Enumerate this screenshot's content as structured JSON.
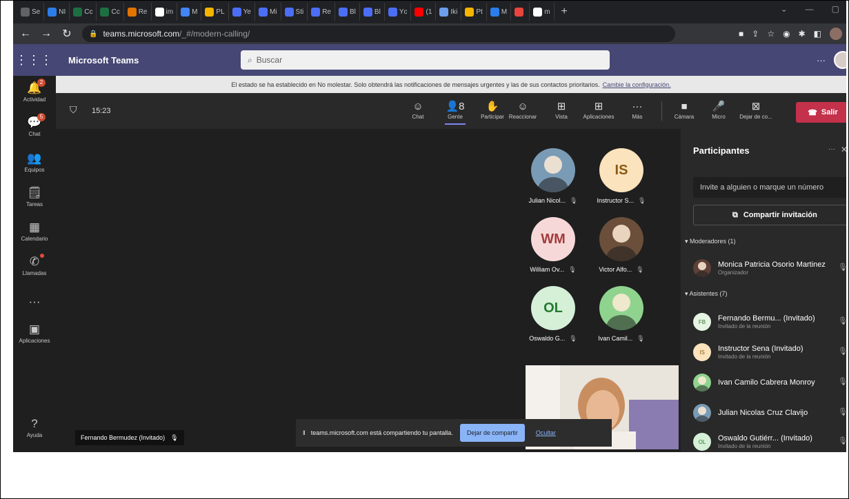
{
  "browser": {
    "tabs": [
      {
        "label": "Se",
        "color": "#5f6368"
      },
      {
        "label": "NI",
        "color": "#2b7de9"
      },
      {
        "label": "Cc",
        "color": "#1d6f42"
      },
      {
        "label": "Cc",
        "color": "#1d6f42"
      },
      {
        "label": "Re",
        "color": "#e37400"
      },
      {
        "label": "im",
        "color": "#ffffff"
      },
      {
        "label": "M",
        "color": "#4285f4"
      },
      {
        "label": "PL",
        "color": "#f4b400"
      },
      {
        "label": "Ye",
        "color": "#4c6ef5"
      },
      {
        "label": "Mi",
        "color": "#4c6ef5"
      },
      {
        "label": "Sti",
        "color": "#4c6ef5"
      },
      {
        "label": "Re",
        "color": "#4c6ef5"
      },
      {
        "label": "Bl",
        "color": "#4c6ef5"
      },
      {
        "label": "Bl",
        "color": "#4c6ef5"
      },
      {
        "label": "Yc",
        "color": "#4c6ef5"
      },
      {
        "label": "(1",
        "color": "#ff0000"
      },
      {
        "label": "Iki",
        "color": "#6d9eeb"
      },
      {
        "label": "Pt",
        "color": "#f4b400"
      },
      {
        "label": "M",
        "color": "#2b7de9"
      },
      {
        "label": "",
        "color": "#e8453c"
      },
      {
        "label": "m",
        "color": "#ffffff"
      }
    ],
    "new_tab": "+",
    "url_host": "teams.microsoft.com",
    "url_path": "/_#/modern-calling/"
  },
  "teams": {
    "app_name": "Microsoft Teams",
    "search_placeholder": "Buscar",
    "more": "···",
    "rail": [
      {
        "label": "Actividad",
        "icon": "bell-icon",
        "glyph": "🔔",
        "badge": "2"
      },
      {
        "label": "Chat",
        "icon": "chat-icon",
        "glyph": "💬",
        "badge": "5"
      },
      {
        "label": "Equipos",
        "icon": "teams-icon",
        "glyph": "👥",
        "badge": ""
      },
      {
        "label": "Tareas",
        "icon": "tasks-icon",
        "glyph": "🗒",
        "badge": ""
      },
      {
        "label": "Calendario",
        "icon": "calendar-icon",
        "glyph": "▦",
        "badge": ""
      },
      {
        "label": "Llamadas",
        "icon": "phone-icon",
        "glyph": "✆",
        "badge": "dot"
      },
      {
        "label": "",
        "icon": "more-icon",
        "glyph": "···",
        "badge": ""
      },
      {
        "label": "Aplicaciones",
        "icon": "apps-icon",
        "glyph": "▣",
        "badge": ""
      }
    ],
    "help_label": "Ayuda",
    "notice_text": "El estado se ha establecido en No molestar. Solo obtendrá las notificaciones de mensajes urgentes y las de sus contactos prioritarios.",
    "notice_link": "Cambie la configuración."
  },
  "meeting": {
    "time": "15:23",
    "toolbar": [
      {
        "label": "Chat",
        "icon": "chat-icon",
        "glyph": "☺"
      },
      {
        "label": "Gente",
        "icon": "people-icon",
        "glyph": "👤8",
        "active": true
      },
      {
        "label": "Participar",
        "icon": "hand-icon",
        "glyph": "✋"
      },
      {
        "label": "Reaccionar",
        "icon": "emoji-icon",
        "glyph": "☺"
      },
      {
        "label": "Vista",
        "icon": "grid-icon",
        "glyph": "⊞"
      },
      {
        "label": "Aplicaciones",
        "icon": "add-app-icon",
        "glyph": "⊞"
      },
      {
        "label": "Más",
        "icon": "more-icon",
        "glyph": "···"
      },
      {
        "label": "Cámara",
        "icon": "camera-icon",
        "glyph": "■"
      },
      {
        "label": "Micro",
        "icon": "mic-icon",
        "glyph": "🎤"
      },
      {
        "label": "Dejar de co...",
        "icon": "stop-share-icon",
        "glyph": "⊠"
      }
    ],
    "leave_label": "Salir",
    "tiles": [
      {
        "name": "Julian Nicol...",
        "initials": "",
        "bg": "#7a9bb5",
        "fg": "#fff"
      },
      {
        "name": "Instructor S...",
        "initials": "IS",
        "bg": "#fbe3bd",
        "fg": "#8a5a12"
      },
      {
        "name": "William Ov...",
        "initials": "WM",
        "bg": "#f7d8d8",
        "fg": "#a33c3c"
      },
      {
        "name": "Victor Alfo...",
        "initials": "",
        "bg": "#6b4f3a",
        "fg": "#fff"
      },
      {
        "name": "Oswaldo G...",
        "initials": "OL",
        "bg": "#d6f0d8",
        "fg": "#237b2f"
      },
      {
        "name": "Ivan Camil...",
        "initials": "",
        "bg": "#8fd38f",
        "fg": "#fff"
      }
    ],
    "presenter_tag": "Fernando Bermudez (Invitado)",
    "share_message": "teams.microsoft.com está compartiendo tu pantalla.",
    "stop_share": "Dejar de compartir",
    "hide": "Ocultar"
  },
  "participants": {
    "title": "Participantes",
    "invite_placeholder": "Invite a alguien o marque un número",
    "share_invite": "Compartir invitación",
    "moderators_header": "Moderadores (1)",
    "attendees_header": "Asistentes (7)",
    "moderators": [
      {
        "name": "Monica Patricia Osorio Martinez",
        "role": "Organizador",
        "initials": "",
        "bg": "#5d4037",
        "fg": "#fff"
      }
    ],
    "attendees": [
      {
        "name": "Fernando Bermu... (Invitado)",
        "role": "Invitado de la reunión",
        "initials": "FB",
        "bg": "#e6f4e4",
        "fg": "#3a6b35"
      },
      {
        "name": "Instructor Sena (Invitado)",
        "role": "Invitado de la reunión",
        "initials": "IS",
        "bg": "#fbe3bd",
        "fg": "#8a5a12"
      },
      {
        "name": "Ivan Camilo Cabrera Monroy",
        "role": "",
        "initials": "",
        "bg": "#8fd38f",
        "fg": "#fff"
      },
      {
        "name": "Julian Nicolas Cruz Clavijo",
        "role": "",
        "initials": "",
        "bg": "#7a9bb5",
        "fg": "#fff"
      },
      {
        "name": "Oswaldo Gutiérr... (Invitado)",
        "role": "Invitado de la reunión",
        "initials": "OL",
        "bg": "#d6f0d8",
        "fg": "#237b2f"
      }
    ]
  }
}
